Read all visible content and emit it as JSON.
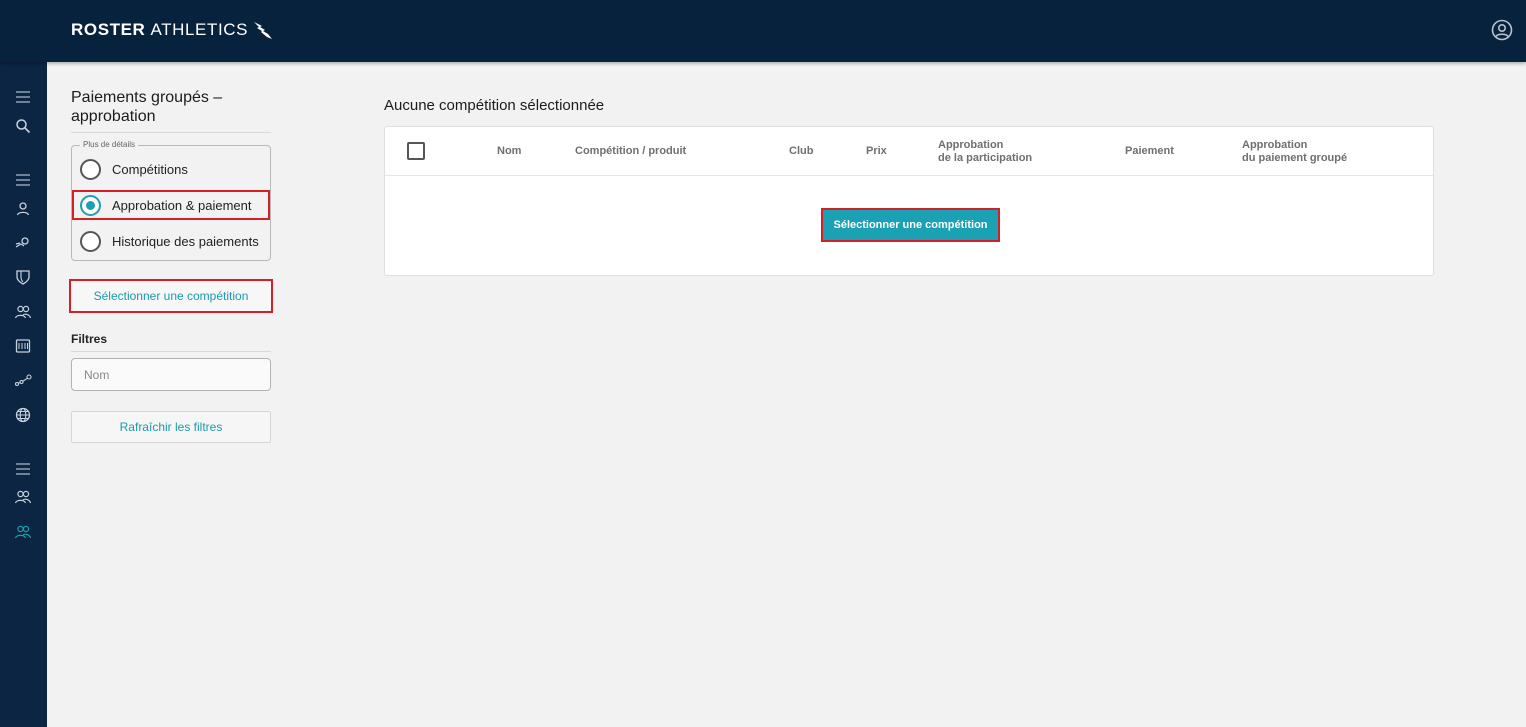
{
  "header": {
    "brand_bold": "ROSTER",
    "brand_regular": "ATHLETICS",
    "logo_icon": "winged-shoe-icon",
    "account_icon": "account-circle-icon"
  },
  "sidenav": {
    "icons": [
      "menu-icon",
      "search-icon",
      "menu-icon",
      "person-icon",
      "athlete-icon",
      "shield-icon",
      "group-icon",
      "calendar-icon",
      "stats-icon",
      "globe-icon",
      "menu-icon",
      "group-icon",
      "group-icon-active"
    ]
  },
  "panel": {
    "title": "Paiements groupés – approbation",
    "legend": "Plus de détails",
    "options": [
      {
        "label": "Compétitions",
        "selected": false
      },
      {
        "label": "Approbation & paiement",
        "selected": true
      },
      {
        "label": "Historique des paiements",
        "selected": false
      }
    ],
    "select_competition": "Sélectionner une compétition",
    "filters_label": "Filtres",
    "name_placeholder": "Nom",
    "refresh_filters": "Rafraîchir les filtres"
  },
  "main": {
    "title": "Aucune compétition sélectionnée",
    "columns": {
      "name": "Nom",
      "competition": "Compétition / produit",
      "club": "Club",
      "price": "Prix",
      "participation_approval_l1": "Approbation",
      "participation_approval_l2": "de la participation",
      "payment": "Paiement",
      "group_payment_approval_l1": "Approbation",
      "group_payment_approval_l2": "du paiement groupé"
    },
    "select_competition_button": "Sélectionner une compétition"
  },
  "colors": {
    "header_bg": "#07223d",
    "sidenav_bg": "#0c2542",
    "accent": "#1aa1b3",
    "highlight": "#d51f26"
  }
}
